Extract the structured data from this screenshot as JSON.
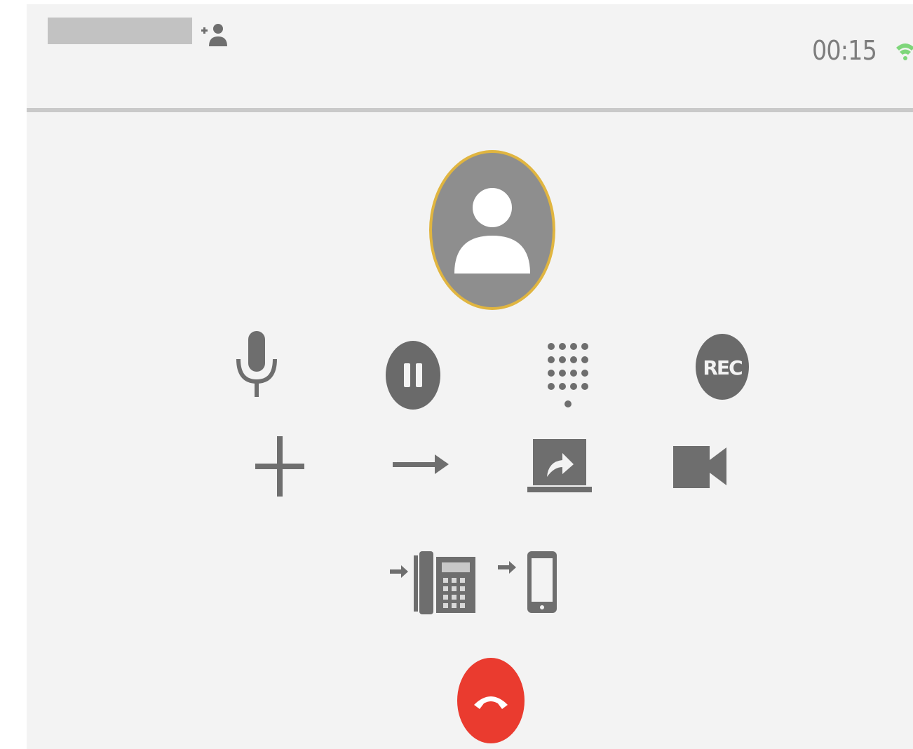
{
  "header": {
    "contact_name": "",
    "call_timer": "00:15",
    "icons": {
      "add_participant": "add-person-icon",
      "signal": "signal-strength-icon"
    }
  },
  "caller": {
    "avatar_icon": "person-avatar-icon",
    "avatar_ring_color": "#e0b540"
  },
  "controls": {
    "row1": [
      {
        "name": "mute",
        "icon": "microphone-icon"
      },
      {
        "name": "hold",
        "icon": "pause-icon"
      },
      {
        "name": "keypad",
        "icon": "dialpad-icon"
      },
      {
        "name": "record",
        "icon": "record-icon",
        "label": "REC"
      }
    ],
    "row2": [
      {
        "name": "add-call",
        "icon": "plus-icon"
      },
      {
        "name": "transfer",
        "icon": "arrow-right-icon"
      },
      {
        "name": "share-screen",
        "icon": "screen-share-icon"
      },
      {
        "name": "video",
        "icon": "video-camera-icon"
      }
    ],
    "row3": [
      {
        "name": "move-to-deskphone",
        "icon": "deskphone-icon"
      },
      {
        "name": "move-to-mobile",
        "icon": "mobile-phone-icon"
      }
    ]
  },
  "end_call": {
    "icon": "hang-up-icon",
    "color": "#ea3b2f"
  },
  "colors": {
    "icon_gray": "#6e6e6e",
    "background": "#f3f3f3",
    "signal": "#7ed67a"
  }
}
